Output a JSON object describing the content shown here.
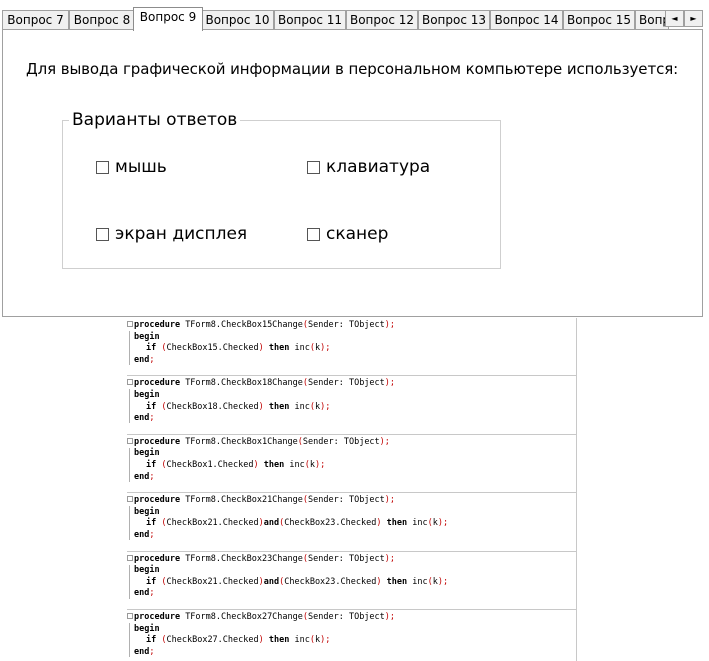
{
  "tabs": [
    {
      "label": "Вопрос 7",
      "active": false
    },
    {
      "label": "Вопрос 8",
      "active": false
    },
    {
      "label": "Вопрос 9",
      "active": true
    },
    {
      "label": "Вопрос 10",
      "active": false
    },
    {
      "label": "Вопрос 11",
      "active": false
    },
    {
      "label": "Вопрос 12",
      "active": false
    },
    {
      "label": "Вопрос 13",
      "active": false
    },
    {
      "label": "Вопрос 14",
      "active": false
    },
    {
      "label": "Вопрос 15",
      "active": false
    },
    {
      "label": "Вопр",
      "active": false
    }
  ],
  "tab_scroll": {
    "left_icon": "◄",
    "right_icon": "►"
  },
  "question": {
    "text": "Для вывода графической информации в персональном компьютере используется:",
    "group_title": "Варианты ответов",
    "options": [
      {
        "label": "мышь",
        "checked": false
      },
      {
        "label": "клавиатура",
        "checked": false
      },
      {
        "label": "экран дисплея",
        "checked": false
      },
      {
        "label": "сканер",
        "checked": false
      }
    ]
  },
  "code": {
    "keywords": {
      "procedure": "procedure",
      "begin": "begin",
      "if": "if",
      "then": "then",
      "end": "end",
      "and": "and"
    },
    "blocks": [
      {
        "name": "TForm8.CheckBox15Change",
        "params": "Sender: TObject",
        "conds": [
          "CheckBox15.Checked"
        ],
        "call": "inc",
        "arg": "k"
      },
      {
        "name": "TForm8.CheckBox18Change",
        "params": "Sender: TObject",
        "conds": [
          "CheckBox18.Checked"
        ],
        "call": "inc",
        "arg": "k"
      },
      {
        "name": "TForm8.CheckBox1Change",
        "params": "Sender: TObject",
        "conds": [
          "CheckBox1.Checked"
        ],
        "call": "inc",
        "arg": "k"
      },
      {
        "name": "TForm8.CheckBox21Change",
        "params": "Sender: TObject",
        "conds": [
          "CheckBox21.Checked",
          "CheckBox23.Checked"
        ],
        "call": "inc",
        "arg": "k"
      },
      {
        "name": "TForm8.CheckBox23Change",
        "params": "Sender: TObject",
        "conds": [
          "CheckBox21.Checked",
          "CheckBox23.Checked"
        ],
        "call": "inc",
        "arg": "k"
      },
      {
        "name": "TForm8.CheckBox27Change",
        "params": "Sender: TObject",
        "conds": [
          "CheckBox27.Checked"
        ],
        "call": "inc",
        "arg": "k"
      }
    ]
  }
}
